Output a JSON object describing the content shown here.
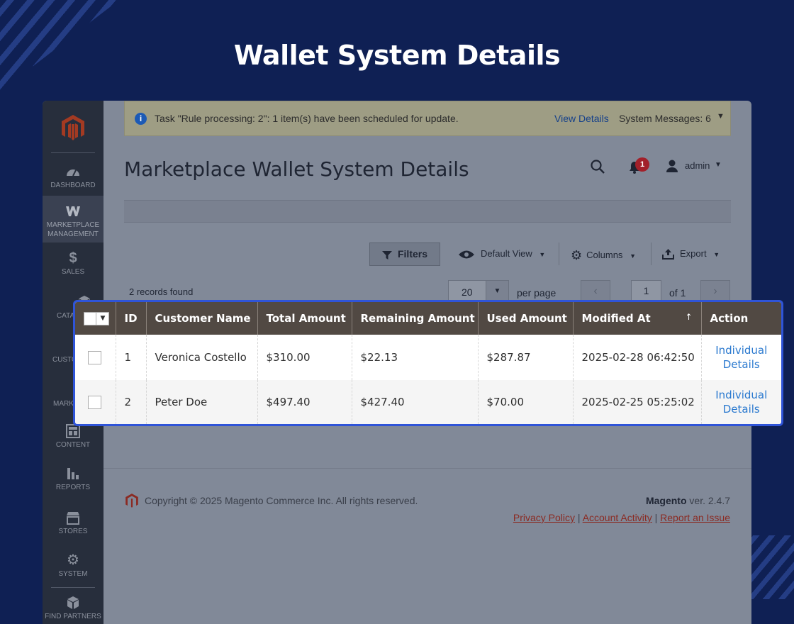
{
  "banner": {
    "title": "Wallet System Details"
  },
  "sidebar": {
    "items": [
      {
        "label": "DASHBOARD",
        "icon": "dashboard-icon"
      },
      {
        "label": "MARKETPLACE MANAGEMENT",
        "icon": "marketplace-icon"
      },
      {
        "label": "SALES",
        "icon": "dollar-icon"
      },
      {
        "label": "CATA",
        "icon": "catalog-icon"
      },
      {
        "label": "CUSTO",
        "icon": "customers-icon"
      },
      {
        "label": "MARK",
        "icon": "marketing-icon"
      },
      {
        "label": "CONTENT",
        "icon": "content-icon"
      },
      {
        "label": "REPORTS",
        "icon": "reports-icon"
      },
      {
        "label": "STORES",
        "icon": "stores-icon"
      },
      {
        "label": "SYSTEM",
        "icon": "gear-icon"
      },
      {
        "label": "FIND PARTNERS",
        "icon": "partners-icon"
      }
    ]
  },
  "system_message": {
    "text": "Task \"Rule processing: 2\": 1 item(s) have been scheduled for update.",
    "view_details": "View Details",
    "system_messages": "System Messages: 6"
  },
  "header": {
    "page_title": "Marketplace Wallet System Details",
    "notification_count": "1",
    "user": "admin"
  },
  "toolbar": {
    "filters": "Filters",
    "default_view": "Default View",
    "columns": "Columns",
    "export": "Export"
  },
  "pager": {
    "records": "2 records found",
    "per_page_value": "20",
    "per_page_label": "per page",
    "page": "1",
    "of_label": "of 1"
  },
  "grid": {
    "columns": [
      "ID",
      "Customer Name",
      "Total Amount",
      "Remaining Amount",
      "Used Amount",
      "Modified At",
      "Action"
    ],
    "sort_indicator": "↑",
    "rows": [
      {
        "id": "1",
        "name": "Veronica Costello",
        "total": "$310.00",
        "remaining": "$22.13",
        "used": "$287.87",
        "modified": "2025-02-28 06:42:50",
        "action": "Individual Details"
      },
      {
        "id": "2",
        "name": "Peter Doe",
        "total": "$497.40",
        "remaining": "$427.40",
        "used": "$70.00",
        "modified": "2025-02-25 05:25:02",
        "action": "Individual Details"
      }
    ]
  },
  "footer": {
    "copyright": "Copyright © 2025 Magento Commerce Inc. All rights reserved.",
    "brand": "Magento",
    "version": "ver. 2.4.7",
    "links": [
      "Privacy Policy",
      "Account Activity",
      "Report an Issue"
    ]
  },
  "colors": {
    "background": "#0f2054",
    "grid_header": "#514943",
    "highlight_border": "#2f54d8",
    "link": "#2a79cf"
  }
}
